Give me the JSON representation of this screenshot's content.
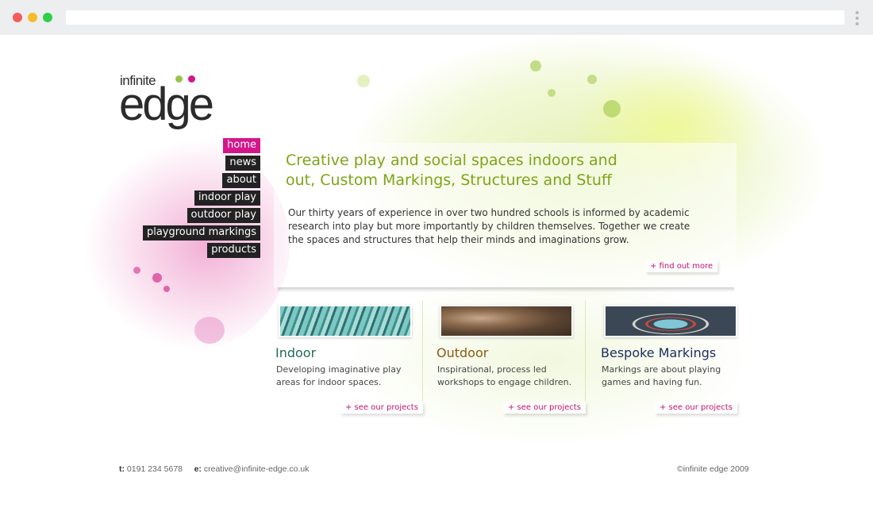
{
  "browser": {
    "url": ""
  },
  "logo": {
    "line1": "infinite",
    "line2": "edge"
  },
  "nav": [
    {
      "label": "home",
      "active": true
    },
    {
      "label": "news"
    },
    {
      "label": "about"
    },
    {
      "label": "indoor play"
    },
    {
      "label": "outdoor play"
    },
    {
      "label": "playground markings"
    },
    {
      "label": "products"
    }
  ],
  "hero": {
    "heading": "Creative play and social spaces indoors and out, Custom Markings, Structures and Stuff",
    "body": "Our thirty years of experience in over two hundred schools is informed by academic research into play but more importantly by children themselves. Together we create the spaces and structures that help their minds and imaginations grow.",
    "link": "+ find out more"
  },
  "cards": [
    {
      "title": "Indoor",
      "title_color": "#1f6b5a",
      "body": "Developing imaginative play areas for indoor spaces.",
      "link": "+ see our projects",
      "icon": "indoor-photo"
    },
    {
      "title": "Outdoor",
      "title_color": "#8a5a12",
      "body": "Inspirational, process led workshops to engage children.",
      "link": "+ see our projects",
      "icon": "outdoor-photo"
    },
    {
      "title": "Bespoke Markings",
      "title_color": "#1b2d5e",
      "body": "Markings are about playing games and having fun.",
      "link": "+ see our projects",
      "icon": "markings-photo"
    }
  ],
  "footer": {
    "tel_label": "t:",
    "tel": "0191 234 5678",
    "email_label": "e:",
    "email": "creative@infinite-edge.co.uk",
    "copyright": "©infinite edge 2009"
  },
  "colors": {
    "accent": "#d4168b",
    "green": "#7ea418",
    "lime": "#9bc34a"
  }
}
